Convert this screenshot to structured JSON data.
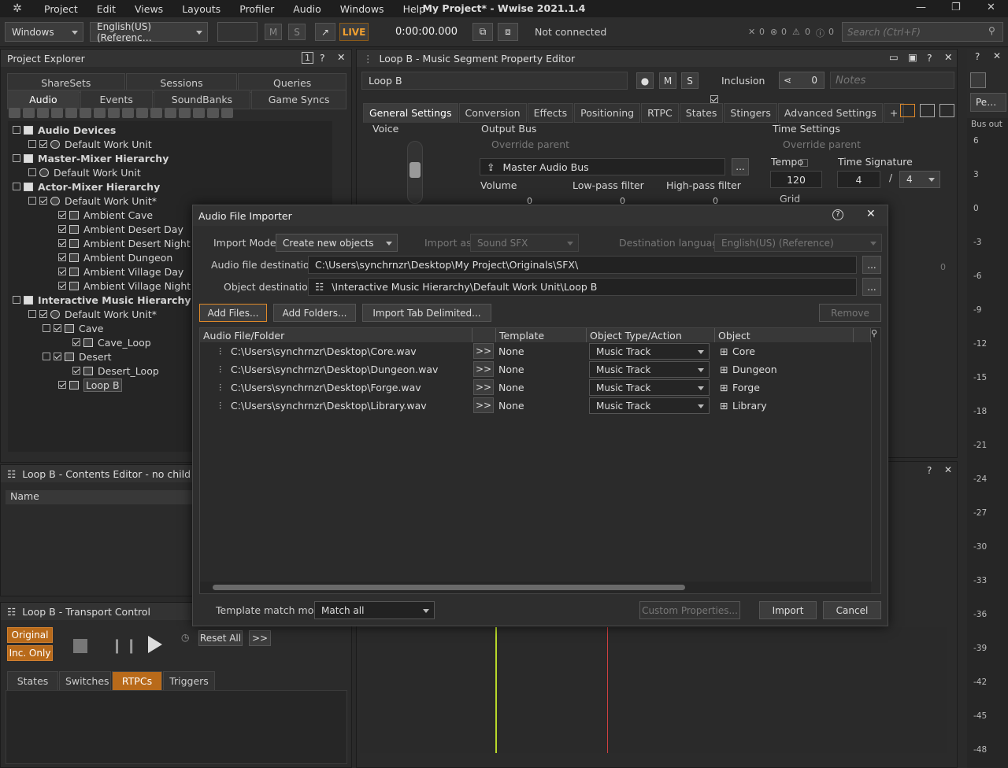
{
  "menubar": {
    "items": [
      "Project",
      "Edit",
      "Views",
      "Layouts",
      "Profiler",
      "Audio",
      "Windows",
      "Help"
    ],
    "title": "My Project* - Wwise 2021.1.4"
  },
  "toolbar": {
    "layout_select": "Windows",
    "language_select": "English(US) (Referenc…",
    "mute_label": "M",
    "solo_label": "S",
    "live_label": "LIVE",
    "time": "0:00:00.000",
    "connection_status": "Not connected",
    "counts": [
      "0",
      "0",
      "0",
      "0"
    ],
    "search_placeholder": "Search (Ctrl+F)"
  },
  "project_explorer": {
    "title": "Project Explorer",
    "tabs_top": [
      "ShareSets",
      "Sessions",
      "Queries"
    ],
    "tabs_bottom": [
      "Audio",
      "Events",
      "SoundBanks",
      "Game Syncs"
    ],
    "tree": [
      {
        "label": "Audio Devices",
        "bold": true
      },
      {
        "label": "Default Work Unit",
        "bold": false
      },
      {
        "label": "Master-Mixer Hierarchy",
        "bold": true
      },
      {
        "label": "Default Work Unit",
        "bold": false
      },
      {
        "label": "Actor-Mixer Hierarchy",
        "bold": true
      },
      {
        "label": "Default Work Unit*",
        "bold": false
      },
      {
        "label": "Ambient Cave",
        "bold": false
      },
      {
        "label": "Ambient Desert Day",
        "bold": false
      },
      {
        "label": "Ambient Desert Night",
        "bold": false
      },
      {
        "label": "Ambient Dungeon",
        "bold": false
      },
      {
        "label": "Ambient Village Day",
        "bold": false
      },
      {
        "label": "Ambient Village Night",
        "bold": false
      },
      {
        "label": "Interactive Music Hierarchy",
        "bold": true
      },
      {
        "label": "Default Work Unit*",
        "bold": false
      },
      {
        "label": "Cave",
        "bold": false
      },
      {
        "label": "Cave_Loop",
        "bold": false
      },
      {
        "label": "Desert",
        "bold": false
      },
      {
        "label": "Desert_Loop",
        "bold": false
      },
      {
        "label": "Loop B",
        "bold": false
      }
    ]
  },
  "property_editor": {
    "title": "Loop B - Music Segment Property Editor",
    "name": "Loop B",
    "mute": "M",
    "solo": "S",
    "inclusion": "Inclusion",
    "share_count": "0",
    "notes_placeholder": "Notes",
    "tabs": [
      "General Settings",
      "Conversion",
      "Effects",
      "Positioning",
      "RTPC",
      "States",
      "Stingers",
      "Advanced Settings",
      "+"
    ],
    "voice_label": "Voice",
    "output_bus_label": "Output Bus",
    "override_parent": "Override parent",
    "bus_name": "Master Audio Bus",
    "volume_label": "Volume",
    "lowpass_label": "Low-pass filter",
    "highpass_label": "High-pass filter",
    "slider_values": [
      "0",
      "0",
      "0"
    ],
    "time_settings": "Time Settings",
    "tempo_label": "Tempo",
    "tempo": "120",
    "time_sig_label": "Time Signature",
    "time_sig_num": "4",
    "time_sig_den": "4",
    "grid_label": "Grid",
    "ellipsis": "...",
    "small_zero": "0"
  },
  "contents_editor": {
    "title": "Loop B - Contents Editor - no child",
    "col_name": "Name"
  },
  "transport": {
    "title": "Loop B - Transport Control",
    "original": "Original",
    "inc_only": "Inc. Only",
    "reset_all": "Reset All",
    "more": ">>",
    "tabs": [
      "States",
      "Switches",
      "RTPCs",
      "Triggers"
    ]
  },
  "meter": {
    "bus_out": "Bus out",
    "dropdown": "Pe…",
    "scale": [
      "6",
      "3",
      "0",
      "-3",
      "-6",
      "-9",
      "-12",
      "-15",
      "-18",
      "-21",
      "-24",
      "-27",
      "-30",
      "-33",
      "-36",
      "-39",
      "-42",
      "-45",
      "-48"
    ]
  },
  "dialog": {
    "title": "Audio File Importer",
    "import_mode_label": "Import Mode:",
    "import_mode": "Create new objects",
    "import_as_label": "Import as:",
    "import_as": "Sound SFX",
    "dest_lang_label": "Destination language:",
    "dest_lang": "English(US) (Reference)",
    "audio_dest_label": "Audio file destination",
    "audio_dest": "C:\\Users\\synchrnzr\\Desktop\\My Project\\Originals\\SFX\\",
    "object_dest_label": "Object destination",
    "object_dest": "\\Interactive Music Hierarchy\\Default Work Unit\\Loop B",
    "browse": "...",
    "add_files": "Add Files...",
    "add_folders": "Add Folders...",
    "import_tab": "Import Tab Delimited...",
    "remove": "Remove",
    "columns": [
      "Audio File/Folder",
      "Template",
      "Object Type/Action",
      "Object"
    ],
    "rows": [
      {
        "file": "C:\\Users\\synchrnzr\\Desktop\\Core.wav",
        "arrow": ">>",
        "template": "None",
        "type": "Music Track",
        "object": "Core"
      },
      {
        "file": "C:\\Users\\synchrnzr\\Desktop\\Dungeon.wav",
        "arrow": ">>",
        "template": "None",
        "type": "Music Track",
        "object": "Dungeon"
      },
      {
        "file": "C:\\Users\\synchrnzr\\Desktop\\Forge.wav",
        "arrow": ">>",
        "template": "None",
        "type": "Music Track",
        "object": "Forge"
      },
      {
        "file": "C:\\Users\\synchrnzr\\Desktop\\Library.wav",
        "arrow": ">>",
        "template": "None",
        "type": "Music Track",
        "object": "Library"
      }
    ],
    "template_match_label": "Template match mode:",
    "template_match": "Match all",
    "custom_props": "Custom Properties...",
    "import": "Import",
    "cancel": "Cancel"
  },
  "colors": {
    "live": "#f0a030",
    "accent_orange": "#e08a2a",
    "playhead_green": "#b8d82a",
    "playhead_red": "#d04040"
  }
}
